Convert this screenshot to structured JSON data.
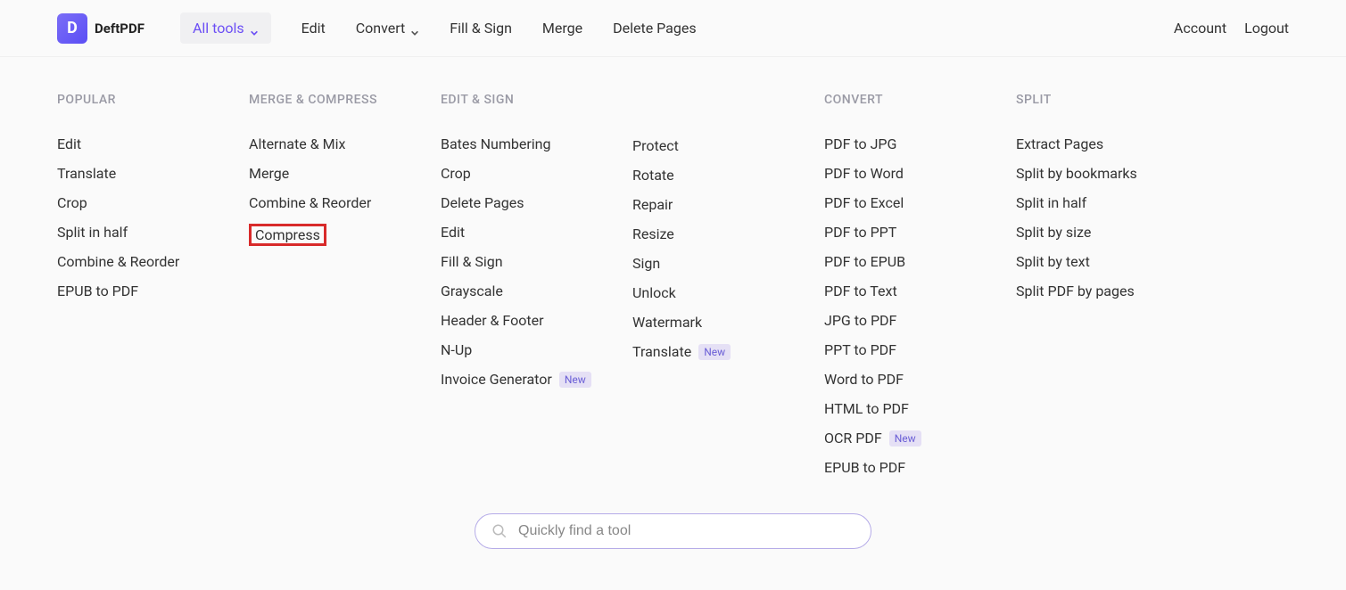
{
  "brand": {
    "name": "DeftPDF",
    "initial": "D"
  },
  "nav": {
    "all_tools": "All tools",
    "edit": "Edit",
    "convert": "Convert",
    "fill_sign": "Fill & Sign",
    "merge": "Merge",
    "delete_pages": "Delete Pages",
    "account": "Account",
    "logout": "Logout"
  },
  "columns": {
    "popular": {
      "heading": "POPULAR",
      "items": [
        "Edit",
        "Translate",
        "Crop",
        "Split in half",
        "Combine & Reorder",
        "EPUB to PDF"
      ]
    },
    "merge_compress": {
      "heading": "MERGE & COMPRESS",
      "items": [
        "Alternate & Mix",
        "Merge",
        "Combine & Reorder",
        "Compress"
      ]
    },
    "edit_sign": {
      "heading": "EDIT & SIGN",
      "col1": [
        {
          "label": "Bates Numbering"
        },
        {
          "label": "Crop"
        },
        {
          "label": "Delete Pages"
        },
        {
          "label": "Edit"
        },
        {
          "label": "Fill & Sign"
        },
        {
          "label": "Grayscale"
        },
        {
          "label": "Header & Footer"
        },
        {
          "label": "N-Up"
        },
        {
          "label": "Invoice Generator",
          "badge": "New"
        }
      ],
      "col2": [
        {
          "label": "Protect"
        },
        {
          "label": "Rotate"
        },
        {
          "label": "Repair"
        },
        {
          "label": "Resize"
        },
        {
          "label": "Sign"
        },
        {
          "label": "Unlock"
        },
        {
          "label": "Watermark"
        },
        {
          "label": "Translate",
          "badge": "New"
        }
      ]
    },
    "convert": {
      "heading": "CONVERT",
      "items": [
        {
          "label": "PDF to JPG"
        },
        {
          "label": "PDF to Word"
        },
        {
          "label": "PDF to Excel"
        },
        {
          "label": "PDF to PPT"
        },
        {
          "label": "PDF to EPUB"
        },
        {
          "label": "PDF to Text"
        },
        {
          "label": "JPG to PDF"
        },
        {
          "label": "PPT to PDF"
        },
        {
          "label": "Word to PDF"
        },
        {
          "label": "HTML to PDF"
        },
        {
          "label": "OCR PDF",
          "badge": "New"
        },
        {
          "label": "EPUB to PDF"
        }
      ]
    },
    "split": {
      "heading": "SPLIT",
      "items": [
        "Extract Pages",
        "Split by bookmarks",
        "Split in half",
        "Split by size",
        "Split by text",
        "Split PDF by pages"
      ]
    }
  },
  "search": {
    "placeholder": "Quickly find a tool"
  }
}
